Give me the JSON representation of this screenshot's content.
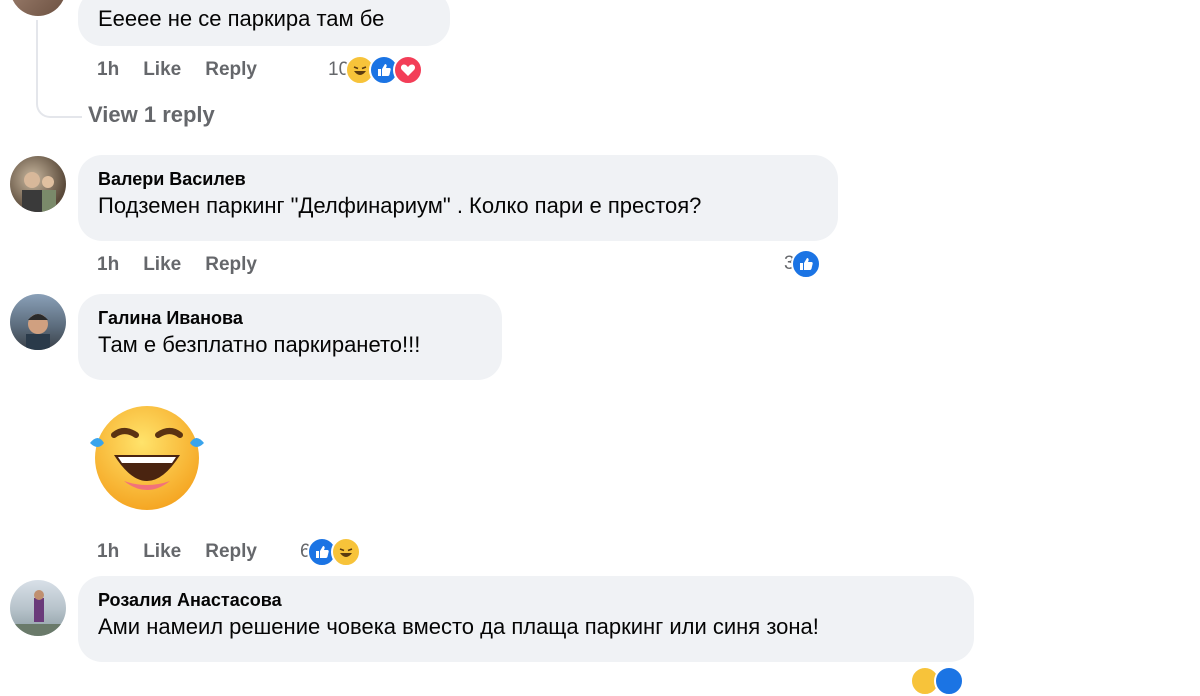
{
  "comments": [
    {
      "text": "Ееееe не се паркира там бе",
      "time": "1h",
      "like": "Like",
      "reply": "Reply",
      "reaction_count": "10",
      "reactions": [
        "haha-icon",
        "like-icon",
        "love-icon"
      ]
    },
    {
      "author": "Валери Василев",
      "text": "Подземен паркинг \"Делфинариум\" . Колко пари е престоя?",
      "time": "1h",
      "like": "Like",
      "reply": "Reply",
      "reaction_count": "3",
      "reactions": [
        "like-icon"
      ]
    },
    {
      "author": "Галина Иванова",
      "text": "Там е безплатно паркирането!!!",
      "sticker": "laughing-emoji-sticker",
      "time": "1h",
      "like": "Like",
      "reply": "Reply",
      "reaction_count": "6",
      "reactions": [
        "like-icon",
        "haha-icon"
      ]
    },
    {
      "author": "Розалия Анастасова",
      "text": "Ами намеил решение човека вместо да плаща паркинг или синя зона!"
    }
  ],
  "view_replies": "View 1 reply",
  "colors": {
    "bubble": "#f0f2f5",
    "meta": "#65676b",
    "like": "#1b74e4",
    "love": "#f33e58",
    "haha": "#f7c33a"
  }
}
